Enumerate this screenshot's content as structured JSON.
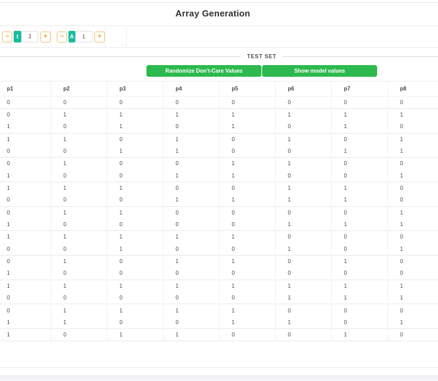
{
  "header": {
    "title": "Array Generation"
  },
  "icons": {
    "minus_glyph": "−",
    "plus_glyph": "+"
  },
  "controls": {
    "spinners": [
      {
        "badge": "t",
        "value": "3"
      },
      {
        "badge": "A",
        "value": "1"
      }
    ]
  },
  "test_set": {
    "legend": "TEST SET",
    "buttons": [
      {
        "label": "Randomize Don't-Care Values"
      },
      {
        "label": "Show model values"
      }
    ]
  },
  "table": {
    "columns": [
      "p1",
      "p2",
      "p3",
      "p4",
      "p5",
      "p6",
      "p7",
      "p8"
    ],
    "rows": [
      [
        0,
        0,
        0,
        0,
        0,
        0,
        0,
        0
      ],
      [
        0,
        1,
        1,
        1,
        1,
        1,
        1,
        1
      ],
      [
        1,
        0,
        1,
        0,
        1,
        0,
        1,
        0
      ],
      [
        1,
        1,
        0,
        1,
        0,
        1,
        0,
        1
      ],
      [
        0,
        0,
        1,
        1,
        0,
        0,
        1,
        1
      ],
      [
        0,
        1,
        0,
        0,
        1,
        1,
        0,
        0
      ],
      [
        1,
        0,
        0,
        1,
        1,
        0,
        0,
        1
      ],
      [
        1,
        1,
        1,
        0,
        0,
        1,
        1,
        0
      ],
      [
        0,
        0,
        0,
        1,
        1,
        1,
        1,
        0
      ],
      [
        0,
        1,
        1,
        0,
        0,
        0,
        0,
        1
      ],
      [
        1,
        0,
        0,
        0,
        0,
        1,
        1,
        1
      ],
      [
        1,
        1,
        1,
        1,
        1,
        0,
        0,
        0
      ],
      [
        0,
        0,
        1,
        0,
        0,
        1,
        0,
        1
      ],
      [
        0,
        1,
        0,
        1,
        1,
        0,
        1,
        0
      ],
      [
        1,
        0,
        0,
        0,
        0,
        0,
        0,
        0
      ],
      [
        1,
        1,
        1,
        1,
        1,
        1,
        1,
        1
      ],
      [
        0,
        0,
        0,
        0,
        0,
        1,
        1,
        1
      ],
      [
        0,
        1,
        1,
        1,
        1,
        0,
        0,
        0
      ],
      [
        1,
        1,
        0,
        0,
        1,
        1,
        0,
        1
      ],
      [
        1,
        0,
        1,
        1,
        0,
        0,
        1,
        0
      ]
    ]
  },
  "colors": {
    "accent_green": "#2db94d",
    "accent_teal": "#18bda1",
    "accent_orange": "#ef9d2f",
    "divider_gray": "#ededed"
  }
}
